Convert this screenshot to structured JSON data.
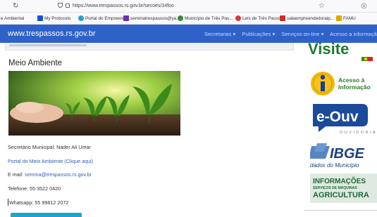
{
  "browser": {
    "back_icon": "refresh-icon",
    "url": "https://www.trespassos.rs.gov.br/secoes/34foo",
    "star_icon": "star-icon",
    "extension_icon": "shield-icon",
    "bookmarks": [
      {
        "label": "e Ambiental",
        "color": "#6e8fbf"
      },
      {
        "label": "My Protocolo",
        "color": "#1d4fd6"
      },
      {
        "label": "Portal do Empreende...",
        "color": "#2aa1c9"
      },
      {
        "label": "semmatrespassos@ya...",
        "color": "#6b2fb3"
      },
      {
        "label": "Município de Três Pas...",
        "color": "#3a8a3a"
      },
      {
        "label": "Leis de Três Passos",
        "color": "#d23b3b"
      },
      {
        "label": "salaempreendedoraip...",
        "color": "#c6302a"
      },
      {
        "label": "FAMU",
        "color": "#e0a800"
      }
    ]
  },
  "site": {
    "logo": "www.trespassos.rs.gov.br",
    "nav": [
      "Secretarias ▾",
      "Publicações ▾",
      "Serviços on-line ▾",
      "Acesso a informação"
    ],
    "header_color": "#2e62c9"
  },
  "main": {
    "title": "Meio Ambiente",
    "secretary": "Secretário Municipal: Nader Ali Umar",
    "portal_link": "Portal do Meio Ambiente (Clique aqui)",
    "email_label": "E mail: ",
    "email_value": "semma@trespassos.rs.gov.br",
    "phone": "Telefone: 55 3522 0420",
    "whatsapp": "Whatsapp: 55 99812 2072"
  },
  "sidebar": {
    "visite": "Visite",
    "acesso_line1": "Acesso à",
    "acesso_line2": "Informação",
    "eouv_title": "e-Ouv",
    "eouv_sub": "OUVIDORIA",
    "ibge_title": "IBGE",
    "ibge_sub": "dados do Município",
    "agri_line1": "INFORMAÇÕES",
    "agri_line2": "SERVIÇOS DE MÁQUINAS",
    "agri_line3": "AGRICULTURA"
  }
}
